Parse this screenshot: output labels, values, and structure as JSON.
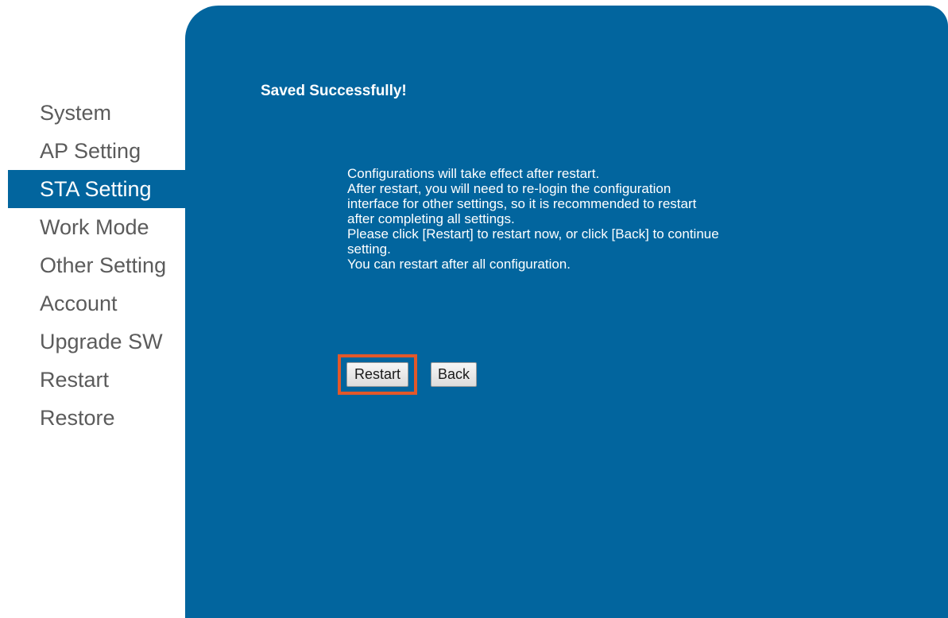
{
  "sidebar": {
    "items": [
      {
        "label": "System",
        "active": false
      },
      {
        "label": "AP Setting",
        "active": false
      },
      {
        "label": "STA Setting",
        "active": true
      },
      {
        "label": "Work Mode",
        "active": false
      },
      {
        "label": "Other Setting",
        "active": false
      },
      {
        "label": "Account",
        "active": false
      },
      {
        "label": "Upgrade SW",
        "active": false
      },
      {
        "label": "Restart",
        "active": false
      },
      {
        "label": "Restore",
        "active": false
      }
    ]
  },
  "main": {
    "title": "Saved Successfully!",
    "message_lines": [
      "Configurations will take effect after restart.",
      "After restart, you will need to re-login the configuration",
      "interface for other settings, so it is recommended to restart",
      "after completing all settings.",
      "Please click [Restart] to restart now, or click [Back] to continue",
      "setting.",
      "You can restart after all configuration."
    ],
    "restart_label": "Restart",
    "back_label": "Back"
  },
  "colors": {
    "panel": "#02659e",
    "highlight": "#e2582a",
    "sidebar_text": "#5b5b5b"
  }
}
